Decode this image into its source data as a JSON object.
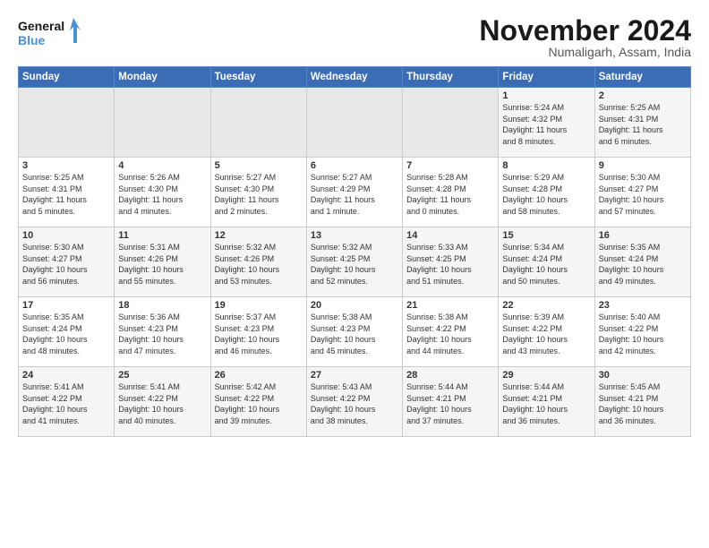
{
  "logo": {
    "line1": "General",
    "line2": "Blue"
  },
  "title": "November 2024",
  "subtitle": "Numaligarh, Assam, India",
  "weekdays": [
    "Sunday",
    "Monday",
    "Tuesday",
    "Wednesday",
    "Thursday",
    "Friday",
    "Saturday"
  ],
  "weeks": [
    [
      {
        "day": "",
        "info": ""
      },
      {
        "day": "",
        "info": ""
      },
      {
        "day": "",
        "info": ""
      },
      {
        "day": "",
        "info": ""
      },
      {
        "day": "",
        "info": ""
      },
      {
        "day": "1",
        "info": "Sunrise: 5:24 AM\nSunset: 4:32 PM\nDaylight: 11 hours\nand 8 minutes."
      },
      {
        "day": "2",
        "info": "Sunrise: 5:25 AM\nSunset: 4:31 PM\nDaylight: 11 hours\nand 6 minutes."
      }
    ],
    [
      {
        "day": "3",
        "info": "Sunrise: 5:25 AM\nSunset: 4:31 PM\nDaylight: 11 hours\nand 5 minutes."
      },
      {
        "day": "4",
        "info": "Sunrise: 5:26 AM\nSunset: 4:30 PM\nDaylight: 11 hours\nand 4 minutes."
      },
      {
        "day": "5",
        "info": "Sunrise: 5:27 AM\nSunset: 4:30 PM\nDaylight: 11 hours\nand 2 minutes."
      },
      {
        "day": "6",
        "info": "Sunrise: 5:27 AM\nSunset: 4:29 PM\nDaylight: 11 hours\nand 1 minute."
      },
      {
        "day": "7",
        "info": "Sunrise: 5:28 AM\nSunset: 4:28 PM\nDaylight: 11 hours\nand 0 minutes."
      },
      {
        "day": "8",
        "info": "Sunrise: 5:29 AM\nSunset: 4:28 PM\nDaylight: 10 hours\nand 58 minutes."
      },
      {
        "day": "9",
        "info": "Sunrise: 5:30 AM\nSunset: 4:27 PM\nDaylight: 10 hours\nand 57 minutes."
      }
    ],
    [
      {
        "day": "10",
        "info": "Sunrise: 5:30 AM\nSunset: 4:27 PM\nDaylight: 10 hours\nand 56 minutes."
      },
      {
        "day": "11",
        "info": "Sunrise: 5:31 AM\nSunset: 4:26 PM\nDaylight: 10 hours\nand 55 minutes."
      },
      {
        "day": "12",
        "info": "Sunrise: 5:32 AM\nSunset: 4:26 PM\nDaylight: 10 hours\nand 53 minutes."
      },
      {
        "day": "13",
        "info": "Sunrise: 5:32 AM\nSunset: 4:25 PM\nDaylight: 10 hours\nand 52 minutes."
      },
      {
        "day": "14",
        "info": "Sunrise: 5:33 AM\nSunset: 4:25 PM\nDaylight: 10 hours\nand 51 minutes."
      },
      {
        "day": "15",
        "info": "Sunrise: 5:34 AM\nSunset: 4:24 PM\nDaylight: 10 hours\nand 50 minutes."
      },
      {
        "day": "16",
        "info": "Sunrise: 5:35 AM\nSunset: 4:24 PM\nDaylight: 10 hours\nand 49 minutes."
      }
    ],
    [
      {
        "day": "17",
        "info": "Sunrise: 5:35 AM\nSunset: 4:24 PM\nDaylight: 10 hours\nand 48 minutes."
      },
      {
        "day": "18",
        "info": "Sunrise: 5:36 AM\nSunset: 4:23 PM\nDaylight: 10 hours\nand 47 minutes."
      },
      {
        "day": "19",
        "info": "Sunrise: 5:37 AM\nSunset: 4:23 PM\nDaylight: 10 hours\nand 46 minutes."
      },
      {
        "day": "20",
        "info": "Sunrise: 5:38 AM\nSunset: 4:23 PM\nDaylight: 10 hours\nand 45 minutes."
      },
      {
        "day": "21",
        "info": "Sunrise: 5:38 AM\nSunset: 4:22 PM\nDaylight: 10 hours\nand 44 minutes."
      },
      {
        "day": "22",
        "info": "Sunrise: 5:39 AM\nSunset: 4:22 PM\nDaylight: 10 hours\nand 43 minutes."
      },
      {
        "day": "23",
        "info": "Sunrise: 5:40 AM\nSunset: 4:22 PM\nDaylight: 10 hours\nand 42 minutes."
      }
    ],
    [
      {
        "day": "24",
        "info": "Sunrise: 5:41 AM\nSunset: 4:22 PM\nDaylight: 10 hours\nand 41 minutes."
      },
      {
        "day": "25",
        "info": "Sunrise: 5:41 AM\nSunset: 4:22 PM\nDaylight: 10 hours\nand 40 minutes."
      },
      {
        "day": "26",
        "info": "Sunrise: 5:42 AM\nSunset: 4:22 PM\nDaylight: 10 hours\nand 39 minutes."
      },
      {
        "day": "27",
        "info": "Sunrise: 5:43 AM\nSunset: 4:22 PM\nDaylight: 10 hours\nand 38 minutes."
      },
      {
        "day": "28",
        "info": "Sunrise: 5:44 AM\nSunset: 4:21 PM\nDaylight: 10 hours\nand 37 minutes."
      },
      {
        "day": "29",
        "info": "Sunrise: 5:44 AM\nSunset: 4:21 PM\nDaylight: 10 hours\nand 36 minutes."
      },
      {
        "day": "30",
        "info": "Sunrise: 5:45 AM\nSunset: 4:21 PM\nDaylight: 10 hours\nand 36 minutes."
      }
    ]
  ]
}
